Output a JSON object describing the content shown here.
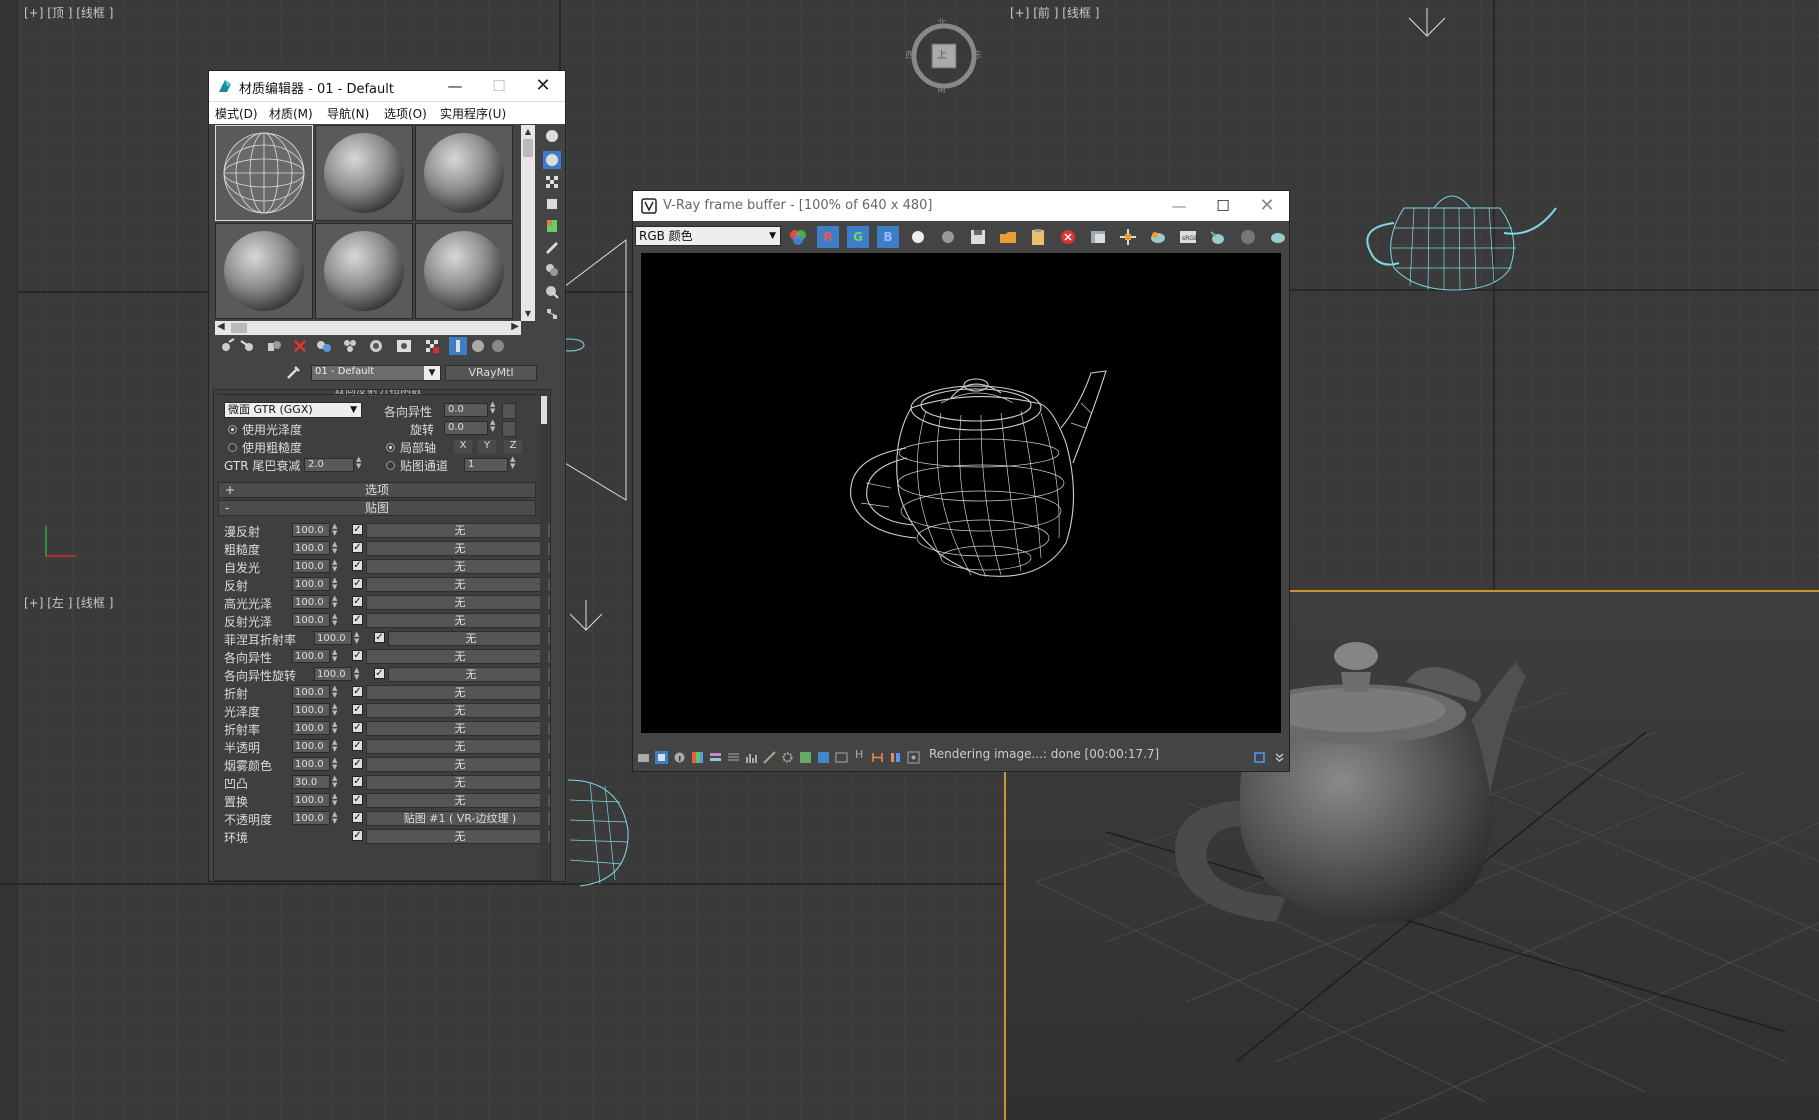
{
  "viewports": {
    "top": {
      "label": "[+] [顶 ] [线框 ]"
    },
    "front": {
      "label": "[+] [前 ] [线框 ]"
    },
    "left": {
      "label": "[+] [左 ] [线框 ]"
    },
    "viewcube": {
      "north": "北",
      "south": "南",
      "east": "东",
      "west": "西",
      "center": "上"
    }
  },
  "material_editor": {
    "title": "材质编辑器 - 01 - Default",
    "menus": [
      "模式(D)",
      "材质(M)",
      "导航(N)",
      "选项(O)",
      "实用程序(U)"
    ],
    "material_name": "01 - Default",
    "material_type": "VRayMtl",
    "brdf": {
      "header": "双向反射分布函数",
      "type": "微面 GTR (GGX)",
      "anisotropy_label": "各向异性",
      "anisotropy_value": "0.0",
      "rotation_label": "旋转",
      "rotation_value": "0.0",
      "use_glossiness": "使用光泽度",
      "use_roughness": "使用粗糙度",
      "local_axis": "局部轴",
      "axes": [
        "X",
        "Y",
        "Z"
      ],
      "map_channel": "贴图通道",
      "map_channel_value": "1",
      "gtr_label": "GTR 尾巴衰减",
      "gtr_value": "2.0"
    },
    "options_rollout": {
      "sign": "+",
      "label": "选项"
    },
    "maps_rollout": {
      "sign": "-",
      "label": "贴图"
    },
    "maps": [
      {
        "label": "漫反射",
        "value": "100.0",
        "map": "无"
      },
      {
        "label": "粗糙度",
        "value": "100.0",
        "map": "无"
      },
      {
        "label": "自发光",
        "value": "100.0",
        "map": "无"
      },
      {
        "label": "反射",
        "value": "100.0",
        "map": "无"
      },
      {
        "label": "高光光泽",
        "value": "100.0",
        "map": "无"
      },
      {
        "label": "反射光泽",
        "value": "100.0",
        "map": "无"
      },
      {
        "label": "菲涅耳折射率",
        "value": "100.0",
        "map": "无"
      },
      {
        "label": "各向异性",
        "value": "100.0",
        "map": "无"
      },
      {
        "label": "各向异性旋转",
        "value": "100.0",
        "map": "无"
      },
      {
        "label": "折射",
        "value": "100.0",
        "map": "无"
      },
      {
        "label": "光泽度",
        "value": "100.0",
        "map": "无"
      },
      {
        "label": "折射率",
        "value": "100.0",
        "map": "无"
      },
      {
        "label": "半透明",
        "value": "100.0",
        "map": "无"
      },
      {
        "label": "烟雾颜色",
        "value": "100.0",
        "map": "无"
      },
      {
        "label": "凹凸",
        "value": "30.0",
        "map": "无"
      },
      {
        "label": "置换",
        "value": "100.0",
        "map": "无"
      },
      {
        "label": "不透明度",
        "value": "100.0",
        "map": "贴图 #1 ( VR-边纹理 )"
      },
      {
        "label": "环境",
        "value": "",
        "map": "无"
      }
    ]
  },
  "vray": {
    "title": "V-Ray frame buffer - [100% of 640 x 480]",
    "channel": "RGB 颜色",
    "rgb_buttons": [
      "R",
      "G",
      "B"
    ],
    "status": "Rendering image...: done [00:00:17.7]",
    "status_h": "H"
  },
  "colors": {
    "accent_blue": "#3d7ec8",
    "wire_cyan": "#7fd8e8",
    "panel": "#444444"
  }
}
